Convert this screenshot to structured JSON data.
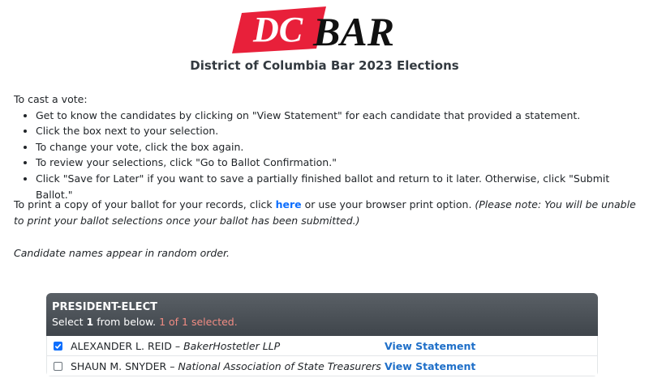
{
  "logo": {
    "part1": "DC",
    "part2": "BAR"
  },
  "page_title": "District of Columbia Bar 2023 Elections",
  "instructions": {
    "intro": "To cast a vote:",
    "items": [
      "Get to know the candidates by clicking on \"View Statement\" for each candidate that provided a statement.",
      "Click the box next to your selection.",
      "To change your vote, click the box again.",
      "To review your selections, click \"Go to Ballot Confirmation.\"",
      "Click \"Save for Later\" if you want to save a partially finished ballot and return to it later. Otherwise, click \"Submit Ballot.\""
    ]
  },
  "print_note": {
    "before": "To print a copy of your ballot for your records, click ",
    "link": "here",
    "after": " or use your browser print option. ",
    "italic": "(Please note: You will be unable to print your ballot selections once your ballot has been submitted.)"
  },
  "random_note": "Candidate names appear in random order.",
  "race": {
    "title": "PRESIDENT-ELECT",
    "select_prefix": "Select ",
    "select_count": "1",
    "select_suffix": " from below.",
    "selected_status": "1 of 1 selected.",
    "candidates": [
      {
        "name": "ALEXANDER L. REID",
        "sep": " – ",
        "firm": "BakerHostetler LLP",
        "link": "View Statement",
        "checked": true
      },
      {
        "name": "SHAUN M. SNYDER",
        "sep": " – ",
        "firm": "National Association of State Treasurers",
        "link": "View Statement",
        "checked": false
      }
    ]
  },
  "colors": {
    "logo_red": "#e8203a",
    "link_blue": "#1f6fc8",
    "header_dark": "#454b51",
    "selected_count": "#f28c83"
  }
}
